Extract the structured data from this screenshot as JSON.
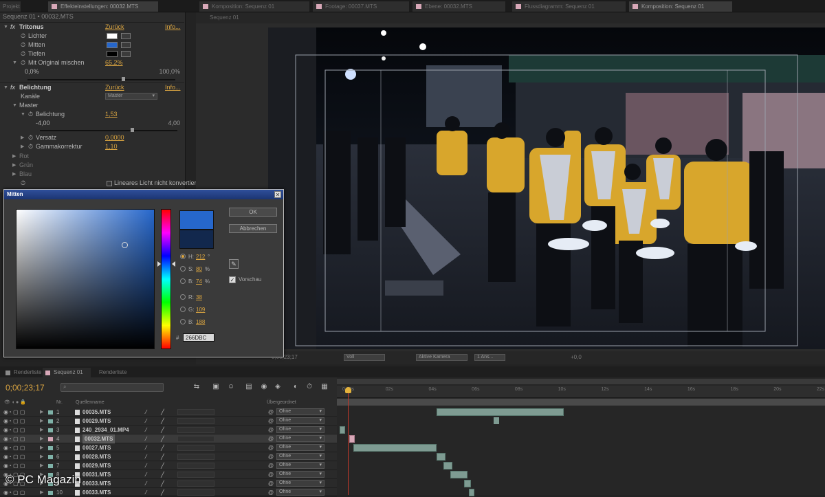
{
  "top_tabs": [
    {
      "label": "Projekt",
      "active": false
    },
    {
      "label": "Effekteinstellungen: 00032.MTS",
      "active": true
    },
    {
      "label": "Komposition: Sequenz 01",
      "active": false
    },
    {
      "label": "Footage: 00037.MTS",
      "active": false
    },
    {
      "label": "Ebene: 00032.MTS",
      "active": false
    },
    {
      "label": "Flussdiagramm: Sequenz 01",
      "active": false
    },
    {
      "label": "Komposition: Sequenz 01",
      "active": true
    }
  ],
  "effects": {
    "breadcrumb": "Sequenz 01 • 00032.MTS",
    "tritonus": {
      "name": "Tritonus",
      "reset": "Zurück",
      "about": "Info...",
      "lichter": "Lichter",
      "mitten": "Mitten",
      "tiefen": "Tiefen",
      "mix_label": "Mit Original mischen",
      "mix_value": "65,2%",
      "range_min": "0,0%",
      "range_max": "100,0%",
      "lichter_color": "#ffffff",
      "mitten_color": "#2667cc",
      "tiefen_color": "#000000"
    },
    "belichtung": {
      "name": "Belichtung",
      "reset": "Zurück",
      "about": "Info...",
      "kanaele_label": "Kanäle",
      "kanaele_value": "Master",
      "master_label": "Master",
      "belichtung_label": "Belichtung",
      "belichtung_value": "1,53",
      "range_min": "-4,00",
      "range_max": "4,00",
      "versatz_label": "Versatz",
      "versatz_value": "0,0000",
      "gamma_label": "Gammakorrektur",
      "gamma_value": "1,10",
      "rot": "Rot",
      "gruen": "Grün",
      "blau": "Blau",
      "linear_label": "Lineares Licht nicht konvertieren"
    }
  },
  "viewer": {
    "tab_label": "Sequenz 01",
    "timecode": "0;00;23;17",
    "quality": "Voll",
    "camera": "Aktive Kamera",
    "views": "1 Ans...",
    "offset": "+0,0"
  },
  "dialog": {
    "title": "Mitten",
    "ok_label": "OK",
    "cancel_label": "Abbrechen",
    "h_label": "H:",
    "h_value": "212",
    "h_unit": "°",
    "s_label": "S:",
    "s_value": "80",
    "s_unit": "%",
    "b_label": "B:",
    "b_value": "74",
    "b_unit": "%",
    "r_label": "R:",
    "r_value": "38",
    "g_label": "G:",
    "g_value": "109",
    "bb_label": "B:",
    "bb_value": "188",
    "hex_value": "266DBC",
    "hex_prefix": "#",
    "preview_label": "Vorschau",
    "new_color": "#2667cc",
    "old_color": "#12284d"
  },
  "timeline": {
    "tabs": [
      {
        "label": "Renderliste",
        "color": "#8a8a8a"
      },
      {
        "label": "Sequenz 01",
        "color": "#d8a8b8"
      },
      {
        "label": "Renderliste",
        "color": "#8a8a8a"
      }
    ],
    "timecode": "0;00;23;17",
    "headers": {
      "nr": "Nr.",
      "source": "Quellenname",
      "parent": "Übergeordnet"
    },
    "ruler_ticks": [
      "0:00s",
      "02s",
      "04s",
      "06s",
      "08s",
      "10s",
      "12s",
      "14s",
      "16s",
      "18s",
      "20s",
      "22s"
    ],
    "layers": [
      {
        "num": "1",
        "name": "00035.MTS",
        "parent": "Ohne",
        "color": "#7fb2a8",
        "selected": false
      },
      {
        "num": "2",
        "name": "00029.MTS",
        "parent": "Ohne",
        "color": "#7fb2a8",
        "selected": false
      },
      {
        "num": "3",
        "name": "240_2934_01.MP4",
        "parent": "Ohne",
        "color": "#7fb2a8",
        "selected": false
      },
      {
        "num": "4",
        "name": "00032.MTS",
        "parent": "Ohne",
        "color": "#d8a8b8",
        "selected": true
      },
      {
        "num": "5",
        "name": "00027.MTS",
        "parent": "Ohne",
        "color": "#7fb2a8",
        "selected": false
      },
      {
        "num": "6",
        "name": "00028.MTS",
        "parent": "Ohne",
        "color": "#7fb2a8",
        "selected": false
      },
      {
        "num": "7",
        "name": "00029.MTS",
        "parent": "Ohne",
        "color": "#7fb2a8",
        "selected": false
      },
      {
        "num": "8",
        "name": "00031.MTS",
        "parent": "Ohne",
        "color": "#7fb2a8",
        "selected": false
      },
      {
        "num": "9",
        "name": "00033.MTS",
        "parent": "Ohne",
        "color": "#7fb2a8",
        "selected": false
      },
      {
        "num": "10",
        "name": "00033.MTS",
        "parent": "Ohne",
        "color": "#7fb2a8",
        "selected": false
      }
    ]
  },
  "watermark": "© PC Magazin",
  "icons": {
    "close": "close-icon",
    "stopwatch": "stopwatch-icon",
    "eyedropper": "eyedropper-icon",
    "eye": "eye-icon",
    "search": "search-icon"
  }
}
